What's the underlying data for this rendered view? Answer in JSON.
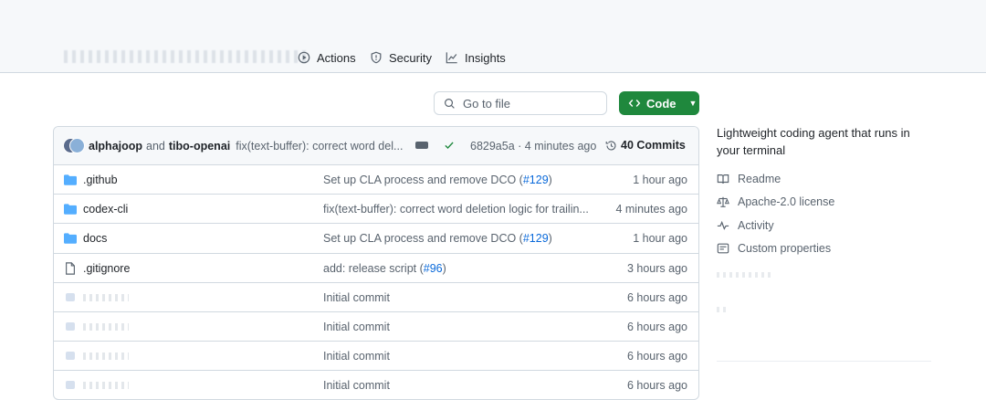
{
  "repo_nav": {
    "tabs": [
      {
        "label": "Actions",
        "icon": "play-circle-icon"
      },
      {
        "label": "Security",
        "icon": "shield-icon"
      },
      {
        "label": "Insights",
        "icon": "graph-icon"
      }
    ]
  },
  "toolbar": {
    "search_placeholder": "Go to file",
    "code_button_label": "Code"
  },
  "latest_commit": {
    "author1": "alphajoop",
    "connector": "and",
    "author2": "tibo-openai",
    "message": "fix(text-buffer): correct word del...",
    "hash_time": "6829a5a · 4 minutes ago",
    "commits_label": "40 Commits"
  },
  "files": [
    {
      "name": ".github",
      "type": "folder",
      "message": "Set up CLA process and remove DCO (",
      "link": "#129",
      "suffix": ")",
      "time": "1 hour ago"
    },
    {
      "name": "codex-cli",
      "type": "folder",
      "message": "fix(text-buffer): correct word deletion logic for trailin...",
      "link": "",
      "suffix": "",
      "time": "4 minutes ago"
    },
    {
      "name": "docs",
      "type": "folder",
      "message": "Set up CLA process and remove DCO (",
      "link": "#129",
      "suffix": ")",
      "time": "1 hour ago"
    },
    {
      "name": ".gitignore",
      "type": "file",
      "message": "add: release script (",
      "link": "#96",
      "suffix": ")",
      "time": "3 hours ago"
    },
    {
      "name": "",
      "type": "blurred",
      "message": "Initial commit",
      "link": "",
      "suffix": "",
      "time": "6 hours ago"
    },
    {
      "name": "",
      "type": "blurred",
      "message": "Initial commit",
      "link": "",
      "suffix": "",
      "time": "6 hours ago"
    },
    {
      "name": "",
      "type": "blurred",
      "message": "Initial commit",
      "link": "",
      "suffix": "",
      "time": "6 hours ago"
    },
    {
      "name": "",
      "type": "blurred",
      "message": "Initial commit",
      "link": "",
      "suffix": "",
      "time": "6 hours ago"
    }
  ],
  "about": {
    "description": "Lightweight coding agent that runs in your terminal",
    "items": [
      {
        "label": "Readme",
        "icon": "book-icon"
      },
      {
        "label": "Apache-2.0 license",
        "icon": "law-icon"
      },
      {
        "label": "Activity",
        "icon": "pulse-icon"
      },
      {
        "label": "Custom properties",
        "icon": "note-icon"
      }
    ]
  },
  "colors": {
    "accent_green": "#1f883d",
    "link_blue": "#0969da",
    "folder_blue": "#54aeff",
    "muted_text": "#59636e"
  }
}
